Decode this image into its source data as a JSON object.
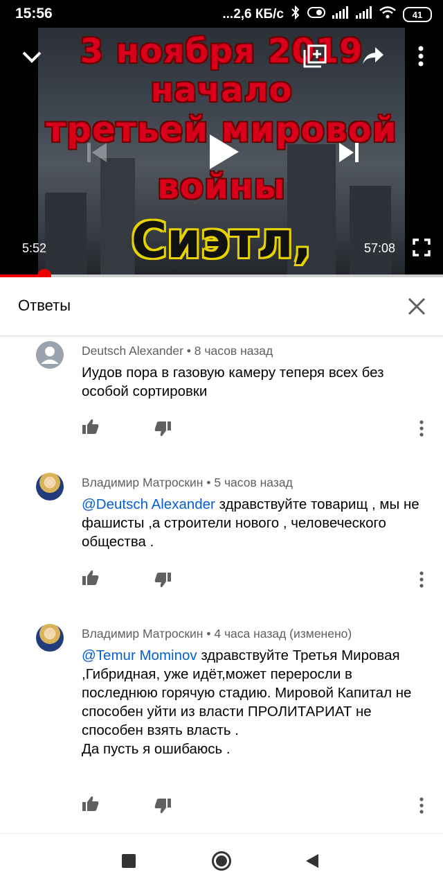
{
  "status_bar": {
    "time": "15:56",
    "network_speed": "...2,6 КБ/с",
    "battery": "41",
    "icons": [
      "bluetooth-icon",
      "toggle-icon",
      "signal-icon",
      "signal-icon",
      "wifi-icon",
      "battery-icon"
    ]
  },
  "player": {
    "thumbnail_lines": [
      "3 ноября 2019",
      "начало",
      "третьей мировой",
      "войны"
    ],
    "thumbnail_highlight": "Сиэтл, США!!",
    "current_time": "5:52",
    "duration": "57:08",
    "progress": 0.1,
    "icons": [
      "collapse-chevron-icon",
      "add-to-playlist-icon",
      "share-icon",
      "more-vert-icon",
      "previous-icon",
      "play-icon",
      "next-icon",
      "fullscreen-icon"
    ]
  },
  "replies": {
    "title": "Ответы",
    "close_icon": "close-icon"
  },
  "comments": [
    {
      "author": "Deutsch Alexander",
      "time": "8 часов назад",
      "mention": "",
      "text": "Иудов пора в газовую камеру теперя всех без особой сортировки"
    },
    {
      "author": "Владимир Матроскин",
      "time": "5 часов назад",
      "mention": "@Deutsch Alexander",
      "text": " здравствуйте товарищ , мы не фашисты ,а строители нового , человеческого общества ."
    },
    {
      "author": "Владимир Матроскин",
      "time": "4 часа назад (изменено)",
      "mention": "@Temur Mominov",
      "text": " здравствуйте Третья Мировая ,Гибридная, уже идёт,может переросли в последнюю горячую стадию. Мировой Капитал не способен уйти из власти ПРОЛИТАРИАТ не способен взять власть .",
      "text2": "Да пусть я ошибаюсь ."
    }
  ],
  "comment_separator": "•",
  "navbar": {
    "icons": [
      "recents-square-icon",
      "home-circle-icon",
      "back-triangle-icon"
    ]
  },
  "colors": {
    "progress": "#e00000",
    "mention": "#065fd4",
    "meta": "#606060"
  }
}
